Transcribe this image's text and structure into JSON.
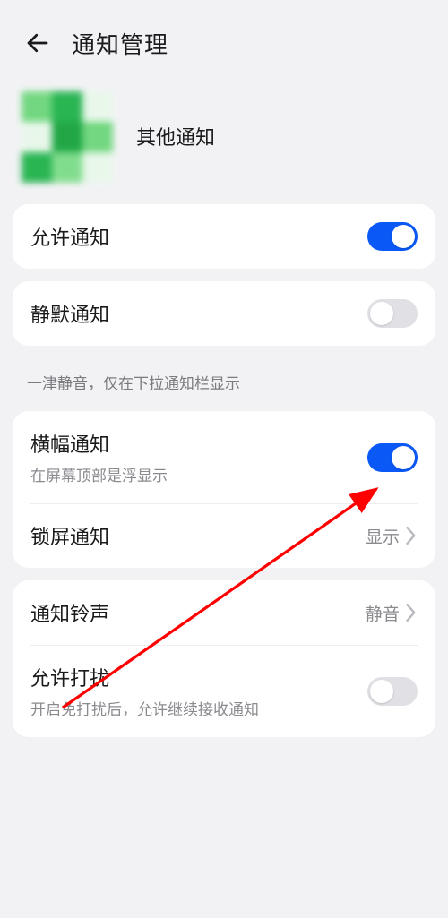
{
  "header": {
    "title": "通知管理"
  },
  "app": {
    "name": "其他通知"
  },
  "allow_notification": {
    "label": "允许通知",
    "enabled": true
  },
  "silent_notification": {
    "label": "静默通知",
    "enabled": false
  },
  "silent_hint": "一津静音，仅在下拉通知栏显示",
  "banner_notification": {
    "label": "横幅通知",
    "sub": "在屏幕顶部是浮显示",
    "enabled": true
  },
  "lockscreen_notification": {
    "label": "锁屏通知",
    "value": "显示"
  },
  "ringtone": {
    "label": "通知铃声",
    "value": "静音"
  },
  "allow_disturb": {
    "label": "允许打扰",
    "sub": "开启免打扰后，允许继续接收通知",
    "enabled": false
  }
}
